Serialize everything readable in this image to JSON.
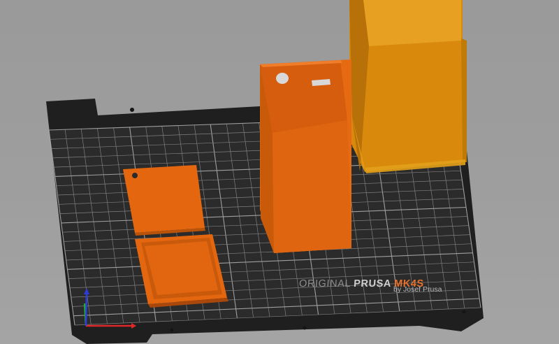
{
  "bed": {
    "brand_prefix": "ORIGINAL ",
    "brand_name": "PRUSA ",
    "brand_model": "MK4S",
    "brand_byline": "by Josef Prusa"
  },
  "colors": {
    "background": "#9e9e9e",
    "bed_sheet": "#2b2b2b",
    "bed_frame": "#1f1f1f",
    "grid_line": "#8f8f8f",
    "part_orange": "#e56a12",
    "part_orange_dark": "#c45608",
    "selected_part": "#d98a0c",
    "axis_x": "#e02828",
    "axis_y": "#1fae34",
    "axis_z": "#2d3cd8"
  },
  "objects": [
    {
      "name": "lid-plate-with-hole"
    },
    {
      "name": "tray-frame"
    },
    {
      "name": "open-box-with-cutouts"
    },
    {
      "name": "selected-tall-box"
    }
  ]
}
